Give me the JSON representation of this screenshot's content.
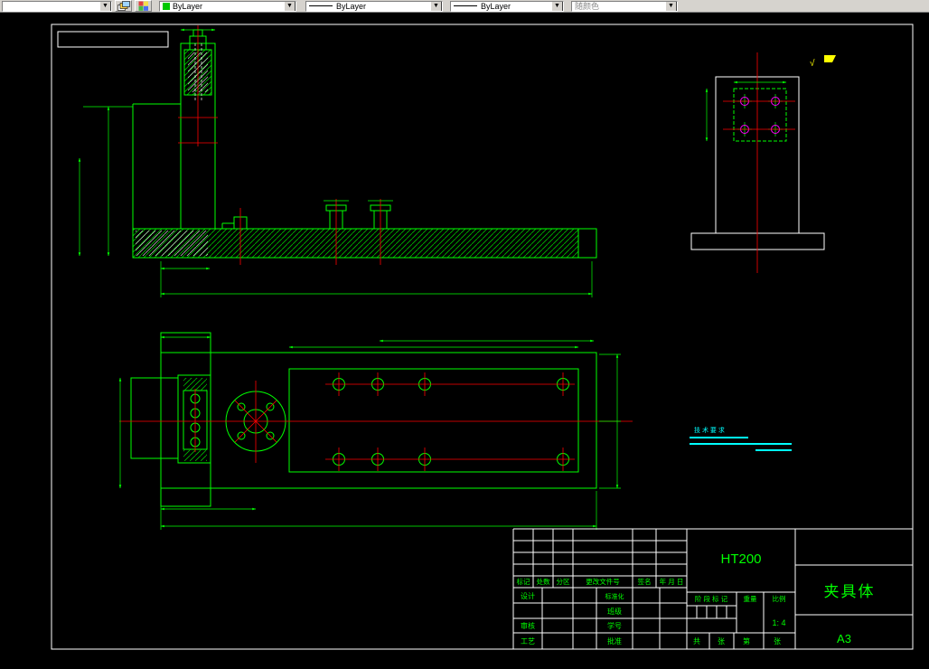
{
  "toolbar": {
    "layer_value": "",
    "color_value": "ByLayer",
    "linetype_value": "ByLayer",
    "lineweight_value": "ByLayer",
    "plotstyle_value": "随颜色"
  },
  "canvas": {
    "notes_title": "技 术 要 求",
    "surface_mark": "√"
  },
  "title_block": {
    "material": "HT200",
    "part_name": "夹具体",
    "paper_size": "A3",
    "scale_value": "1: 4",
    "header_cells": [
      "标记",
      "处数",
      "分区",
      "更改文件号",
      "签名",
      "年 月 日"
    ],
    "design": "设计",
    "standardization": "标准化",
    "class_label": "班级",
    "check": "审核",
    "student_no": "学号",
    "process": "工艺",
    "approve": "批准",
    "stage_mark": "阶 段 标 记",
    "weight": "重量",
    "scale_label": "比例",
    "sheets_total": "共",
    "sheets_unit1": "张",
    "sheets_ordinal": "第",
    "sheets_unit2": "张"
  }
}
